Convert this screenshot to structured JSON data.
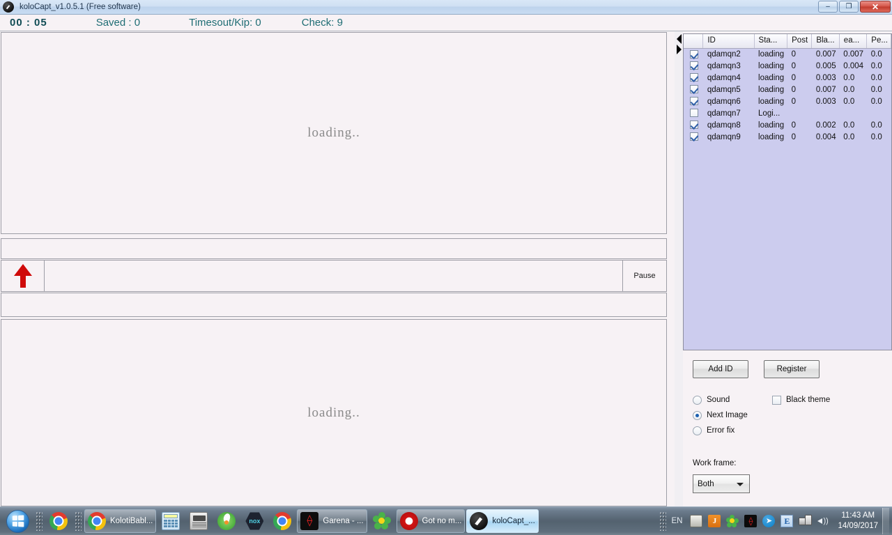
{
  "window": {
    "title": "koloCapt_v1.0.5.1 (Free software)",
    "icon": "hammer-icon",
    "minimize_label": "–",
    "maximize_label": "❐",
    "close_label": "✕"
  },
  "status_bar": {
    "timer": "00 : 05",
    "saved": "Saved : 0",
    "timeout": "Timesout/Kip: 0",
    "check": "Check: 9"
  },
  "main": {
    "top_image_text": "loading..",
    "bottom_image_text": "loading..",
    "pause_label": "Pause",
    "arrow_icon": "arrow-up-icon"
  },
  "table": {
    "columns": [
      "",
      "ID",
      "Sta...",
      "Post",
      "Bla...",
      "ea...",
      "Pe..."
    ],
    "rows": [
      {
        "checked": true,
        "id": "qdamqn2",
        "status": "loading",
        "post": "0",
        "bla": "0.007",
        "ea": "0.007",
        "pe": "0.0"
      },
      {
        "checked": true,
        "id": "qdamqn3",
        "status": "loading",
        "post": "0",
        "bla": "0.005",
        "ea": "0.004",
        "pe": "0.0"
      },
      {
        "checked": true,
        "id": "qdamqn4",
        "status": "loading",
        "post": "0",
        "bla": "0.003",
        "ea": "0.0",
        "pe": "0.0"
      },
      {
        "checked": true,
        "id": "qdamqn5",
        "status": "loading",
        "post": "0",
        "bla": "0.007",
        "ea": "0.0",
        "pe": "0.0"
      },
      {
        "checked": true,
        "id": "qdamqn6",
        "status": "loading",
        "post": "0",
        "bla": "0.003",
        "ea": "0.0",
        "pe": "0.0"
      },
      {
        "checked": false,
        "id": "qdamqn7",
        "status": "Logi...",
        "post": "",
        "bla": "",
        "ea": "",
        "pe": ""
      },
      {
        "checked": true,
        "id": "qdamqn8",
        "status": "loading",
        "post": "0",
        "bla": "0.002",
        "ea": "0.0",
        "pe": "0.0"
      },
      {
        "checked": true,
        "id": "qdamqn9",
        "status": "loading",
        "post": "0",
        "bla": "0.004",
        "ea": "0.0",
        "pe": "0.0"
      }
    ]
  },
  "controls": {
    "add_id_label": "Add ID",
    "register_label": "Register",
    "sound_label": "Sound",
    "next_image_label": "Next Image",
    "error_fix_label": "Error fix",
    "black_theme_label": "Black theme",
    "selected_radio": "Next Image",
    "black_theme_checked": false,
    "work_frame_label": "Work frame:",
    "work_frame_value": "Both"
  },
  "taskbar": {
    "start_label": "Start",
    "items": [
      {
        "name": "chrome-quicklaunch",
        "icon": "chrome-icon",
        "label": "",
        "state": "quicklaunch"
      },
      {
        "name": "chrome-kolotibablo",
        "icon": "chrome-icon",
        "label": "KolotiBabl...",
        "state": "boxed"
      },
      {
        "name": "calculator",
        "icon": "calculator-icon",
        "label": "",
        "state": "quicklaunch"
      },
      {
        "name": "fax-printer",
        "icon": "fax-icon",
        "label": "",
        "state": "quicklaunch"
      },
      {
        "name": "swirl-app",
        "icon": "swirl-icon",
        "label": "",
        "state": "quicklaunch"
      },
      {
        "name": "nox-player",
        "icon": "nox-icon",
        "label": "",
        "state": "quicklaunch"
      },
      {
        "name": "chrome-second",
        "icon": "chrome-icon",
        "label": "",
        "state": "quicklaunch"
      },
      {
        "name": "garena",
        "icon": "garena-icon",
        "label": "Garena - ...",
        "state": "boxed"
      },
      {
        "name": "icq",
        "icon": "icq-icon",
        "label": "",
        "state": "quicklaunch"
      },
      {
        "name": "opera-got-no-m",
        "icon": "opera-icon",
        "label": "Got no m...",
        "state": "boxed"
      },
      {
        "name": "kolocapt",
        "icon": "hammer-icon",
        "label": "koloCapt_...",
        "state": "active"
      }
    ],
    "tray": {
      "language": "EN",
      "icons": [
        "keyboard-icon",
        "java-icon",
        "icq-icon",
        "garena-icon",
        "telegram-icon",
        "ie-icon",
        "network-icon",
        "volume-icon"
      ],
      "time": "11:43 AM",
      "date": "14/09/2017"
    }
  }
}
